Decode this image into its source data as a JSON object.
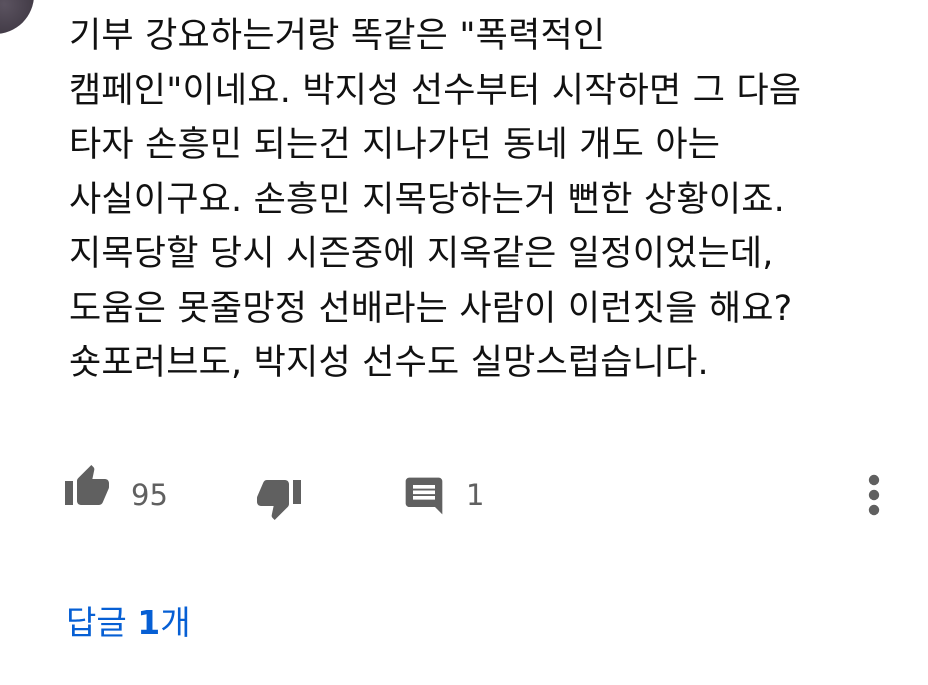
{
  "comment": {
    "lines": [
      "기부 강요하는거랑 똑같은 \"폭력적인",
      "캠페인\"이네요. 박지성 선수부터 시작하면 그 다음",
      "타자 손흥민 되는건 지나가던 동네 개도 아는",
      "사실이구요. 손흥민 지목당하는거 뻔한 상황이죠.",
      "지목당할 당시 시즌중에 지옥같은 일정이었는데,",
      "도움은 못줄망정 선배라는 사람이 이런짓을 해요?",
      "숏포러브도, 박지성 선수도 실망스럽습니다."
    ]
  },
  "actions": {
    "like_count": "95",
    "reply_count": "1",
    "like_icon": "thumb-up-icon",
    "dislike_icon": "thumb-down-icon",
    "reply_icon": "comment-icon",
    "more_icon": "more-vertical-icon"
  },
  "replies": {
    "label_prefix": "답글 ",
    "count": "1",
    "label_suffix": "개"
  },
  "colors": {
    "text": "#111111",
    "meta": "#606060",
    "icon": "#606060",
    "link": "#065fd4"
  }
}
